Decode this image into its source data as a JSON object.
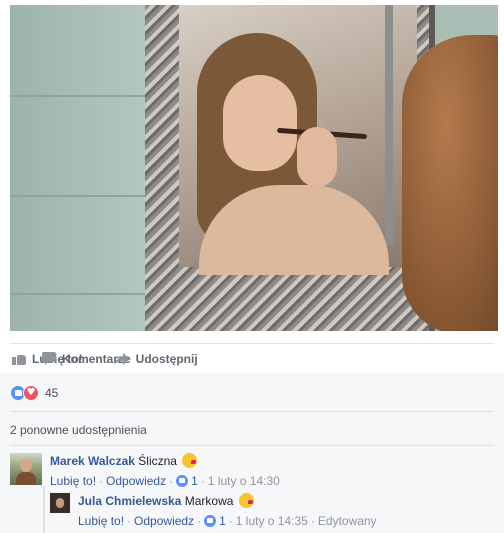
{
  "photo": {
    "alt": "Woman applying makeup in an ornate silver mirror"
  },
  "actions": {
    "like_label": "Lubię to!",
    "comment_label": "Komentarze",
    "share_label": "Udostępnij"
  },
  "reactions": {
    "count": "45",
    "types": [
      "like",
      "love"
    ]
  },
  "shares": {
    "text": "2 ponowne udostępnienia"
  },
  "comments": [
    {
      "author": "Marek Walczak",
      "text": "Śliczna",
      "emoji": "kiss-emoji",
      "like_label": "Lubię to!",
      "reply_label": "Odpowiedz",
      "likes": "1",
      "timestamp": "1 luty o 14:30",
      "edited": ""
    },
    {
      "author": "Jula Chmielewska",
      "text": "Markowa",
      "emoji": "kiss-emoji",
      "like_label": "Lubię to!",
      "reply_label": "Odpowiedz",
      "likes": "1",
      "timestamp": "1 luty o 14:35",
      "edited": "Edytowany"
    }
  ],
  "colors": {
    "link": "#365899",
    "muted": "#90949c",
    "like_blue": "#5890ff",
    "love_red": "#f25268"
  }
}
